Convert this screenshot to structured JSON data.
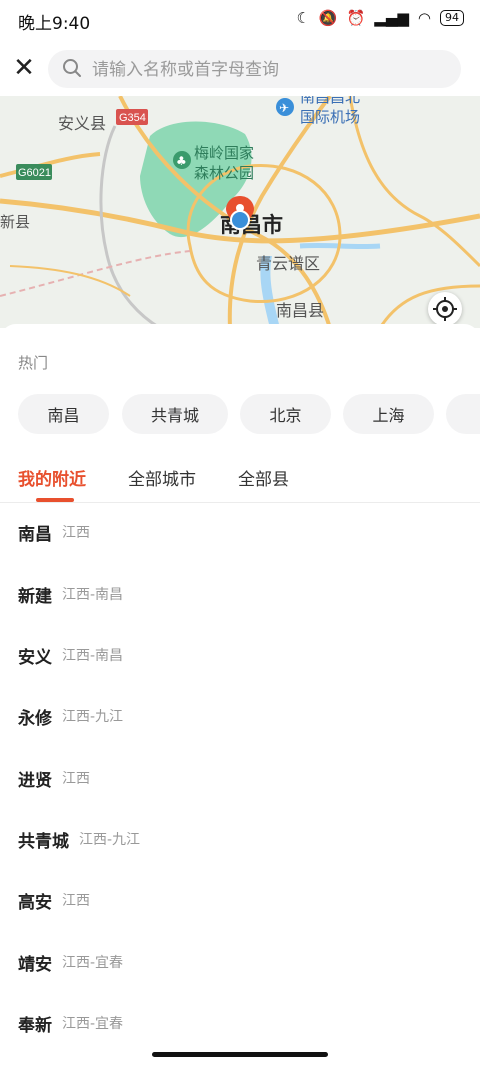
{
  "status_bar": {
    "time": "晚上9:40",
    "battery": "94"
  },
  "search": {
    "placeholder": "请输入名称或首字母查询"
  },
  "map": {
    "labels": {
      "anyi_county": "安义县",
      "g354": "G354",
      "g6021": "G6021",
      "meiling": "梅岭国家森林公园",
      "meiling_line1": "梅岭国家",
      "meiling_line2": "森林公园",
      "city": "南昌市",
      "qingyunpu": "青云谱区",
      "nanchang_county": "南昌县",
      "airport_line1": "南昌昌北",
      "airport_line2": "国际机场",
      "xinjian_county": "新县"
    }
  },
  "hot": {
    "title": "热门",
    "cities": [
      "南昌",
      "共青城",
      "北京",
      "上海",
      "广"
    ]
  },
  "tabs": [
    "我的附近",
    "全部城市",
    "全部县"
  ],
  "active_tab": "我的附近",
  "nearby": [
    {
      "name": "南昌",
      "region": "江西"
    },
    {
      "name": "新建",
      "region": "江西-南昌"
    },
    {
      "name": "安义",
      "region": "江西-南昌"
    },
    {
      "name": "永修",
      "region": "江西-九江"
    },
    {
      "name": "进贤",
      "region": "江西"
    },
    {
      "name": "共青城",
      "region": "江西-九江"
    },
    {
      "name": "高安",
      "region": "江西"
    },
    {
      "name": "靖安",
      "region": "江西-宜春"
    },
    {
      "name": "奉新",
      "region": "江西-宜春"
    }
  ],
  "colors": {
    "accent": "#e8502e",
    "park": "#8fd9b6",
    "road_major": "#f3c26a",
    "water": "#a8d6f5"
  }
}
